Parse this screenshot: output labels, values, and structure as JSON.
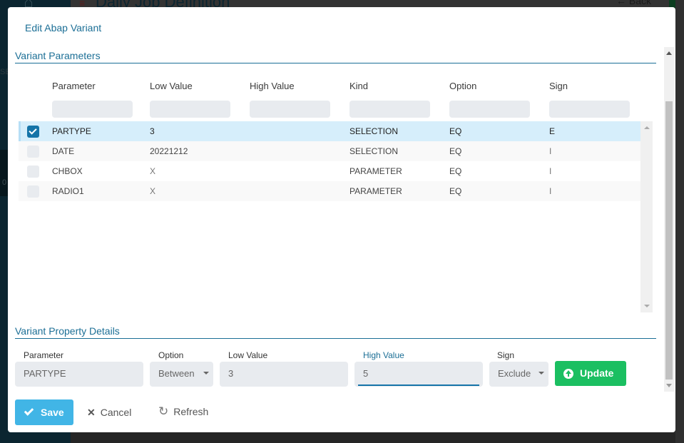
{
  "background": {
    "page_title": "Daily Job Definition",
    "back_label": "Back",
    "sidebar_fragment_1": "SE",
    "sidebar_fragment_2": "0"
  },
  "modal": {
    "title": "Edit Abap Variant",
    "variant_parameters": {
      "section_title": "Variant Parameters",
      "columns": [
        "Parameter",
        "Low Value",
        "High Value",
        "Kind",
        "Option",
        "Sign"
      ],
      "rows": [
        {
          "selected": true,
          "parameter": "PARTYPE",
          "low_value": "3",
          "high_value": "",
          "kind": "SELECTION",
          "option": "EQ",
          "sign": "E"
        },
        {
          "selected": false,
          "parameter": "DATE",
          "low_value": "20221212",
          "high_value": "",
          "kind": "SELECTION",
          "option": "EQ",
          "sign": "I"
        },
        {
          "selected": false,
          "parameter": "CHBOX",
          "low_value": "X",
          "high_value": "",
          "kind": "PARAMETER",
          "option": "EQ",
          "sign": "I"
        },
        {
          "selected": false,
          "parameter": "RADIO1",
          "low_value": "X",
          "high_value": "",
          "kind": "PARAMETER",
          "option": "EQ",
          "sign": "I"
        }
      ]
    },
    "property_details": {
      "section_title": "Variant Property Details",
      "parameter": {
        "label": "Parameter",
        "value": "PARTYPE"
      },
      "option": {
        "label": "Option",
        "value": "Between"
      },
      "low_value": {
        "label": "Low Value",
        "value": "3"
      },
      "high_value": {
        "label": "High Value",
        "value": "5"
      },
      "sign": {
        "label": "Sign",
        "value": "Exclude"
      },
      "update_label": "Update"
    },
    "footer": {
      "save_label": "Save",
      "cancel_label": "Cancel",
      "refresh_label": "Refresh"
    }
  },
  "colors": {
    "accent": "#1c6f96",
    "save_button": "#41b5e6",
    "update_button": "#1bbf61",
    "selected_row": "#d6eefb",
    "checkbox_checked": "#1574a8"
  }
}
